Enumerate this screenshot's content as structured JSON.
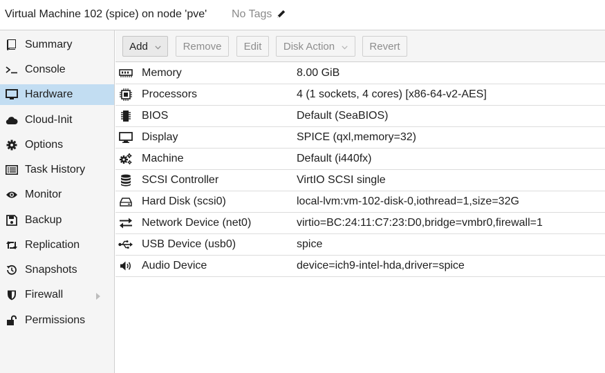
{
  "header": {
    "title": "Virtual Machine 102 (spice) on node 'pve'",
    "tags_label": "No Tags",
    "tags_icon": "pencil-icon"
  },
  "sidebar": {
    "items": [
      {
        "label": "Summary",
        "icon": "book-icon"
      },
      {
        "label": "Console",
        "icon": "terminal-icon"
      },
      {
        "label": "Hardware",
        "icon": "monitor-icon",
        "active": true
      },
      {
        "label": "Cloud-Init",
        "icon": "cloud-icon"
      },
      {
        "label": "Options",
        "icon": "gear-icon"
      },
      {
        "label": "Task History",
        "icon": "list-icon"
      },
      {
        "label": "Monitor",
        "icon": "eye-icon"
      },
      {
        "label": "Backup",
        "icon": "floppy-icon"
      },
      {
        "label": "Replication",
        "icon": "retweet-icon"
      },
      {
        "label": "Snapshots",
        "icon": "history-icon"
      },
      {
        "label": "Firewall",
        "icon": "shield-icon",
        "has_submenu": true
      },
      {
        "label": "Permissions",
        "icon": "unlock-icon"
      }
    ]
  },
  "toolbar": {
    "buttons": [
      {
        "label": "Add",
        "enabled": true,
        "dropdown": true
      },
      {
        "label": "Remove",
        "enabled": false
      },
      {
        "label": "Edit",
        "enabled": false
      },
      {
        "label": "Disk Action",
        "enabled": false,
        "dropdown": true
      },
      {
        "label": "Revert",
        "enabled": false
      }
    ]
  },
  "hardware": {
    "rows": [
      {
        "icon": "memory-icon",
        "name": "Memory",
        "value": "8.00 GiB"
      },
      {
        "icon": "cpu-icon",
        "name": "Processors",
        "value": "4 (1 sockets, 4 cores) [x86-64-v2-AES]"
      },
      {
        "icon": "chip-icon",
        "name": "BIOS",
        "value": "Default (SeaBIOS)"
      },
      {
        "icon": "display-icon",
        "name": "Display",
        "value": "SPICE (qxl,memory=32)"
      },
      {
        "icon": "cogs-icon",
        "name": "Machine",
        "value": "Default (i440fx)"
      },
      {
        "icon": "database-icon",
        "name": "SCSI Controller",
        "value": "VirtIO SCSI single"
      },
      {
        "icon": "hdd-icon",
        "name": "Hard Disk (scsi0)",
        "value": "local-lvm:vm-102-disk-0,iothread=1,size=32G"
      },
      {
        "icon": "exchange-icon",
        "name": "Network Device (net0)",
        "value": "virtio=BC:24:11:C7:23:D0,bridge=vmbr0,firewall=1"
      },
      {
        "icon": "usb-icon",
        "name": "USB Device (usb0)",
        "value": "spice"
      },
      {
        "icon": "volume-icon",
        "name": "Audio Device",
        "value": "device=ich9-intel-hda,driver=spice"
      }
    ]
  },
  "colors": {
    "selected_nav": "#c2ddf2",
    "panel_bg": "#f5f5f5",
    "border": "#cfcfcf",
    "disabled_text": "#8d8d8d"
  }
}
